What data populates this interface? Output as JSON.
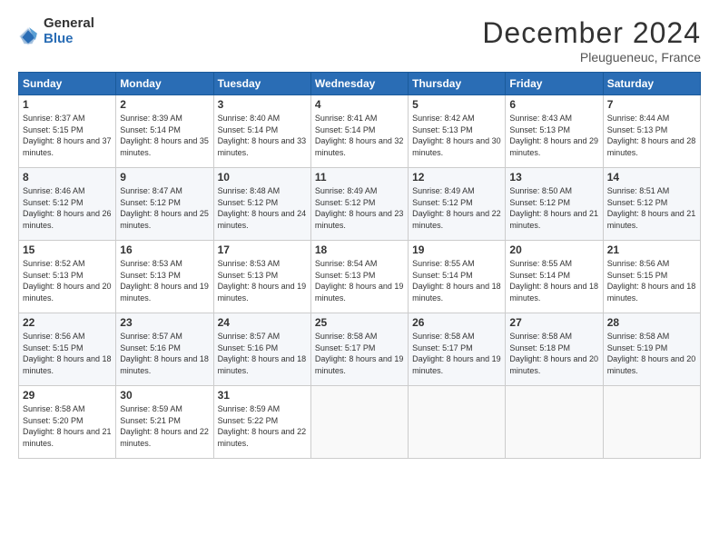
{
  "header": {
    "logo_general": "General",
    "logo_blue": "Blue",
    "title": "December 2024",
    "location": "Pleugueneuc, France"
  },
  "weekdays": [
    "Sunday",
    "Monday",
    "Tuesday",
    "Wednesday",
    "Thursday",
    "Friday",
    "Saturday"
  ],
  "weeks": [
    [
      {
        "day": "1",
        "sunrise": "Sunrise: 8:37 AM",
        "sunset": "Sunset: 5:15 PM",
        "daylight": "Daylight: 8 hours and 37 minutes."
      },
      {
        "day": "2",
        "sunrise": "Sunrise: 8:39 AM",
        "sunset": "Sunset: 5:14 PM",
        "daylight": "Daylight: 8 hours and 35 minutes."
      },
      {
        "day": "3",
        "sunrise": "Sunrise: 8:40 AM",
        "sunset": "Sunset: 5:14 PM",
        "daylight": "Daylight: 8 hours and 33 minutes."
      },
      {
        "day": "4",
        "sunrise": "Sunrise: 8:41 AM",
        "sunset": "Sunset: 5:14 PM",
        "daylight": "Daylight: 8 hours and 32 minutes."
      },
      {
        "day": "5",
        "sunrise": "Sunrise: 8:42 AM",
        "sunset": "Sunset: 5:13 PM",
        "daylight": "Daylight: 8 hours and 30 minutes."
      },
      {
        "day": "6",
        "sunrise": "Sunrise: 8:43 AM",
        "sunset": "Sunset: 5:13 PM",
        "daylight": "Daylight: 8 hours and 29 minutes."
      },
      {
        "day": "7",
        "sunrise": "Sunrise: 8:44 AM",
        "sunset": "Sunset: 5:13 PM",
        "daylight": "Daylight: 8 hours and 28 minutes."
      }
    ],
    [
      {
        "day": "8",
        "sunrise": "Sunrise: 8:46 AM",
        "sunset": "Sunset: 5:12 PM",
        "daylight": "Daylight: 8 hours and 26 minutes."
      },
      {
        "day": "9",
        "sunrise": "Sunrise: 8:47 AM",
        "sunset": "Sunset: 5:12 PM",
        "daylight": "Daylight: 8 hours and 25 minutes."
      },
      {
        "day": "10",
        "sunrise": "Sunrise: 8:48 AM",
        "sunset": "Sunset: 5:12 PM",
        "daylight": "Daylight: 8 hours and 24 minutes."
      },
      {
        "day": "11",
        "sunrise": "Sunrise: 8:49 AM",
        "sunset": "Sunset: 5:12 PM",
        "daylight": "Daylight: 8 hours and 23 minutes."
      },
      {
        "day": "12",
        "sunrise": "Sunrise: 8:49 AM",
        "sunset": "Sunset: 5:12 PM",
        "daylight": "Daylight: 8 hours and 22 minutes."
      },
      {
        "day": "13",
        "sunrise": "Sunrise: 8:50 AM",
        "sunset": "Sunset: 5:12 PM",
        "daylight": "Daylight: 8 hours and 21 minutes."
      },
      {
        "day": "14",
        "sunrise": "Sunrise: 8:51 AM",
        "sunset": "Sunset: 5:12 PM",
        "daylight": "Daylight: 8 hours and 21 minutes."
      }
    ],
    [
      {
        "day": "15",
        "sunrise": "Sunrise: 8:52 AM",
        "sunset": "Sunset: 5:13 PM",
        "daylight": "Daylight: 8 hours and 20 minutes."
      },
      {
        "day": "16",
        "sunrise": "Sunrise: 8:53 AM",
        "sunset": "Sunset: 5:13 PM",
        "daylight": "Daylight: 8 hours and 19 minutes."
      },
      {
        "day": "17",
        "sunrise": "Sunrise: 8:53 AM",
        "sunset": "Sunset: 5:13 PM",
        "daylight": "Daylight: 8 hours and 19 minutes."
      },
      {
        "day": "18",
        "sunrise": "Sunrise: 8:54 AM",
        "sunset": "Sunset: 5:13 PM",
        "daylight": "Daylight: 8 hours and 19 minutes."
      },
      {
        "day": "19",
        "sunrise": "Sunrise: 8:55 AM",
        "sunset": "Sunset: 5:14 PM",
        "daylight": "Daylight: 8 hours and 18 minutes."
      },
      {
        "day": "20",
        "sunrise": "Sunrise: 8:55 AM",
        "sunset": "Sunset: 5:14 PM",
        "daylight": "Daylight: 8 hours and 18 minutes."
      },
      {
        "day": "21",
        "sunrise": "Sunrise: 8:56 AM",
        "sunset": "Sunset: 5:15 PM",
        "daylight": "Daylight: 8 hours and 18 minutes."
      }
    ],
    [
      {
        "day": "22",
        "sunrise": "Sunrise: 8:56 AM",
        "sunset": "Sunset: 5:15 PM",
        "daylight": "Daylight: 8 hours and 18 minutes."
      },
      {
        "day": "23",
        "sunrise": "Sunrise: 8:57 AM",
        "sunset": "Sunset: 5:16 PM",
        "daylight": "Daylight: 8 hours and 18 minutes."
      },
      {
        "day": "24",
        "sunrise": "Sunrise: 8:57 AM",
        "sunset": "Sunset: 5:16 PM",
        "daylight": "Daylight: 8 hours and 18 minutes."
      },
      {
        "day": "25",
        "sunrise": "Sunrise: 8:58 AM",
        "sunset": "Sunset: 5:17 PM",
        "daylight": "Daylight: 8 hours and 19 minutes."
      },
      {
        "day": "26",
        "sunrise": "Sunrise: 8:58 AM",
        "sunset": "Sunset: 5:17 PM",
        "daylight": "Daylight: 8 hours and 19 minutes."
      },
      {
        "day": "27",
        "sunrise": "Sunrise: 8:58 AM",
        "sunset": "Sunset: 5:18 PM",
        "daylight": "Daylight: 8 hours and 20 minutes."
      },
      {
        "day": "28",
        "sunrise": "Sunrise: 8:58 AM",
        "sunset": "Sunset: 5:19 PM",
        "daylight": "Daylight: 8 hours and 20 minutes."
      }
    ],
    [
      {
        "day": "29",
        "sunrise": "Sunrise: 8:58 AM",
        "sunset": "Sunset: 5:20 PM",
        "daylight": "Daylight: 8 hours and 21 minutes."
      },
      {
        "day": "30",
        "sunrise": "Sunrise: 8:59 AM",
        "sunset": "Sunset: 5:21 PM",
        "daylight": "Daylight: 8 hours and 22 minutes."
      },
      {
        "day": "31",
        "sunrise": "Sunrise: 8:59 AM",
        "sunset": "Sunset: 5:22 PM",
        "daylight": "Daylight: 8 hours and 22 minutes."
      },
      null,
      null,
      null,
      null
    ]
  ]
}
